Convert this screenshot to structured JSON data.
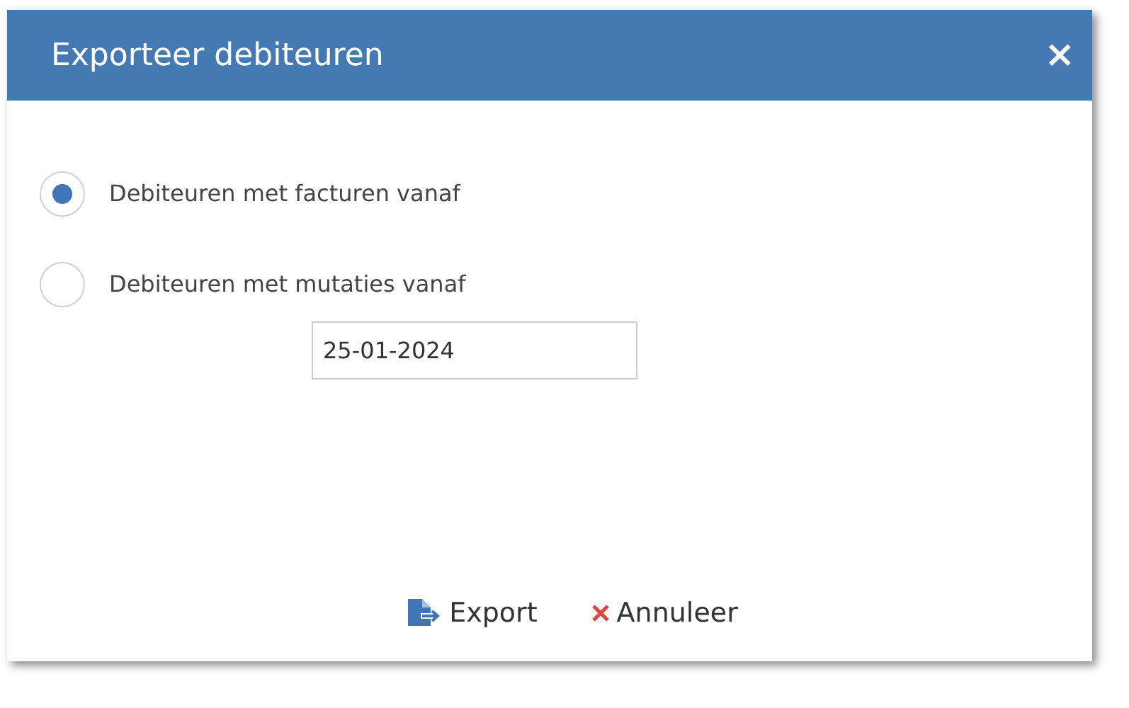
{
  "window": {
    "title": "Exporteer debiteuren",
    "close": "×"
  },
  "options": [
    {
      "label": "Debiteuren met facturen vanaf",
      "selected": true
    },
    {
      "label": "Debiteuren met mutaties vanaf",
      "selected": false
    }
  ],
  "date_field": {
    "value": "25-01-2024"
  },
  "buttons": [
    {
      "kind": "export",
      "label": "Export"
    },
    {
      "kind": "cancel",
      "label": "Annuleer"
    }
  ]
}
